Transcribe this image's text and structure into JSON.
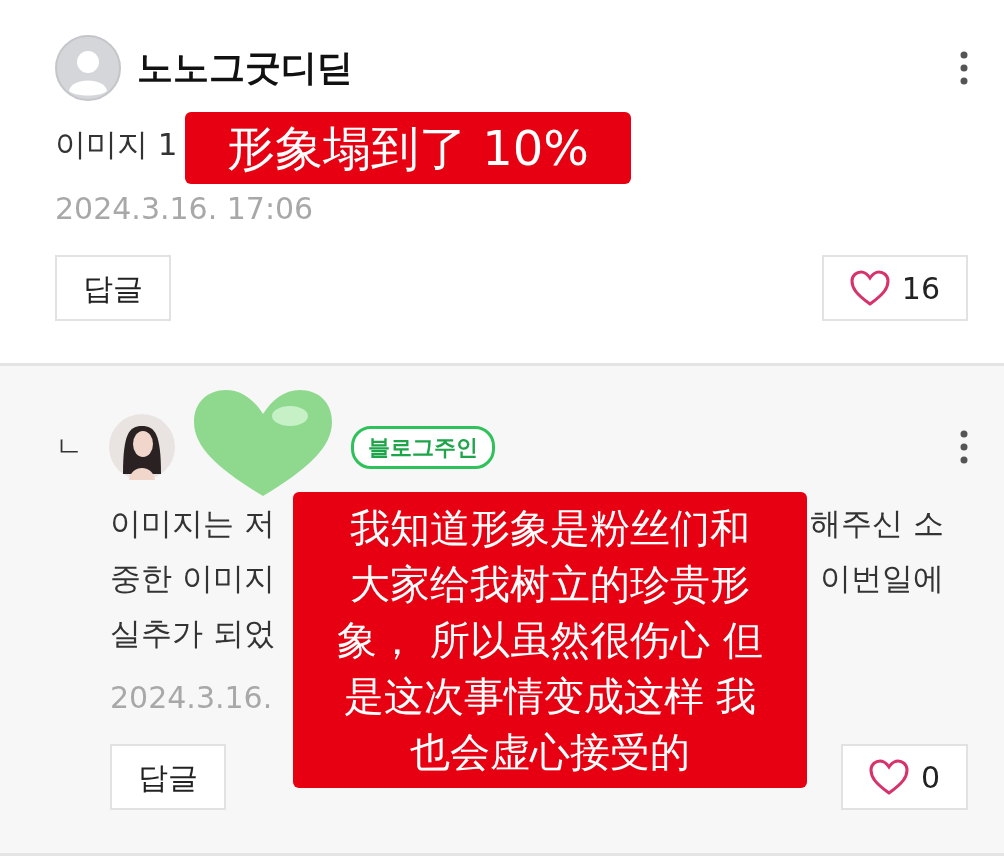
{
  "comments": [
    {
      "kind": "comment",
      "author": "노노그굿디딛",
      "lines": [
        {
          "left": "이미지 1"
        }
      ],
      "date": "2024.3.16. 17:06",
      "reply_button": "답글",
      "likes": "16",
      "caption": [
        "形象塌到了 10%"
      ]
    },
    {
      "kind": "reply",
      "reply_mark": "ㄴ",
      "badge": "블로그주인",
      "lines": [
        {
          "left": "이미지는 저",
          "right": "해주신 소"
        },
        {
          "left": "중한 이미지",
          "right": "이번일에"
        },
        {
          "left": "실추가 되었"
        }
      ],
      "date": "2024.3.16.",
      "reply_button": "답글",
      "likes": "0",
      "caption": [
        "我知道形象是粉丝们和",
        "大家给我树立的珍贵形",
        "象， 所以虽然很伤心 但",
        "是这次事情变成这样 我",
        "也会虚心接受的"
      ]
    }
  ]
}
